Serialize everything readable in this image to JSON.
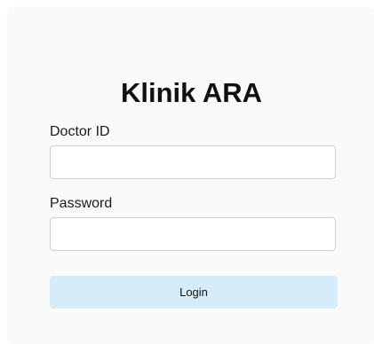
{
  "login_form": {
    "title": "Klinik ARA",
    "doctor_id": {
      "label": "Doctor ID",
      "value": "",
      "placeholder": ""
    },
    "password": {
      "label": "Password",
      "value": "",
      "placeholder": ""
    },
    "login_button": {
      "label": "Login",
      "color": "#d6ecfb"
    }
  }
}
